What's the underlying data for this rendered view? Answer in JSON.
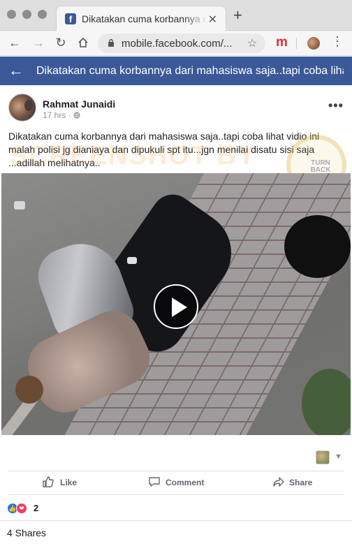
{
  "browser": {
    "tab_title": "Dikatakan cuma korbannya dari mahasiswa saja..tapi coba lihat vidio ini",
    "tab_favicon": "f",
    "tab_close": "✕",
    "new_tab": "+",
    "url": "mobile.facebook.com/...",
    "extension_label": "m",
    "icons": [
      "back-arrow-icon",
      "forward-arrow-icon",
      "reload-icon",
      "home-icon",
      "lock-icon",
      "star-icon",
      "menu-icon"
    ]
  },
  "fb_header": {
    "title": "Dikatakan cuma korbannya dari mahasiswa saja..tapi coba lihat vidio ini",
    "brand_color": "#3b5998"
  },
  "post": {
    "author": "Rahmat Junaidi",
    "time": "17 hrs",
    "audience_icon": "globe-icon",
    "text": "Dikatakan cuma korbannya dari mahasiswa saja..tapi coba lihat vidio ini malah polisi jg dianiaya dan dipukuli spt itu...jgn menilai disatu sisi saja ...adillah melihatnya..",
    "watermark_text": "SCREENSHOT BY",
    "watermark_badge": "TURN BACK HOAX"
  },
  "actions": {
    "like": "Like",
    "comment": "Comment",
    "share": "Share"
  },
  "stats": {
    "reaction_count": "2",
    "shares": "4 Shares",
    "reaction_types": [
      "like",
      "love"
    ]
  }
}
